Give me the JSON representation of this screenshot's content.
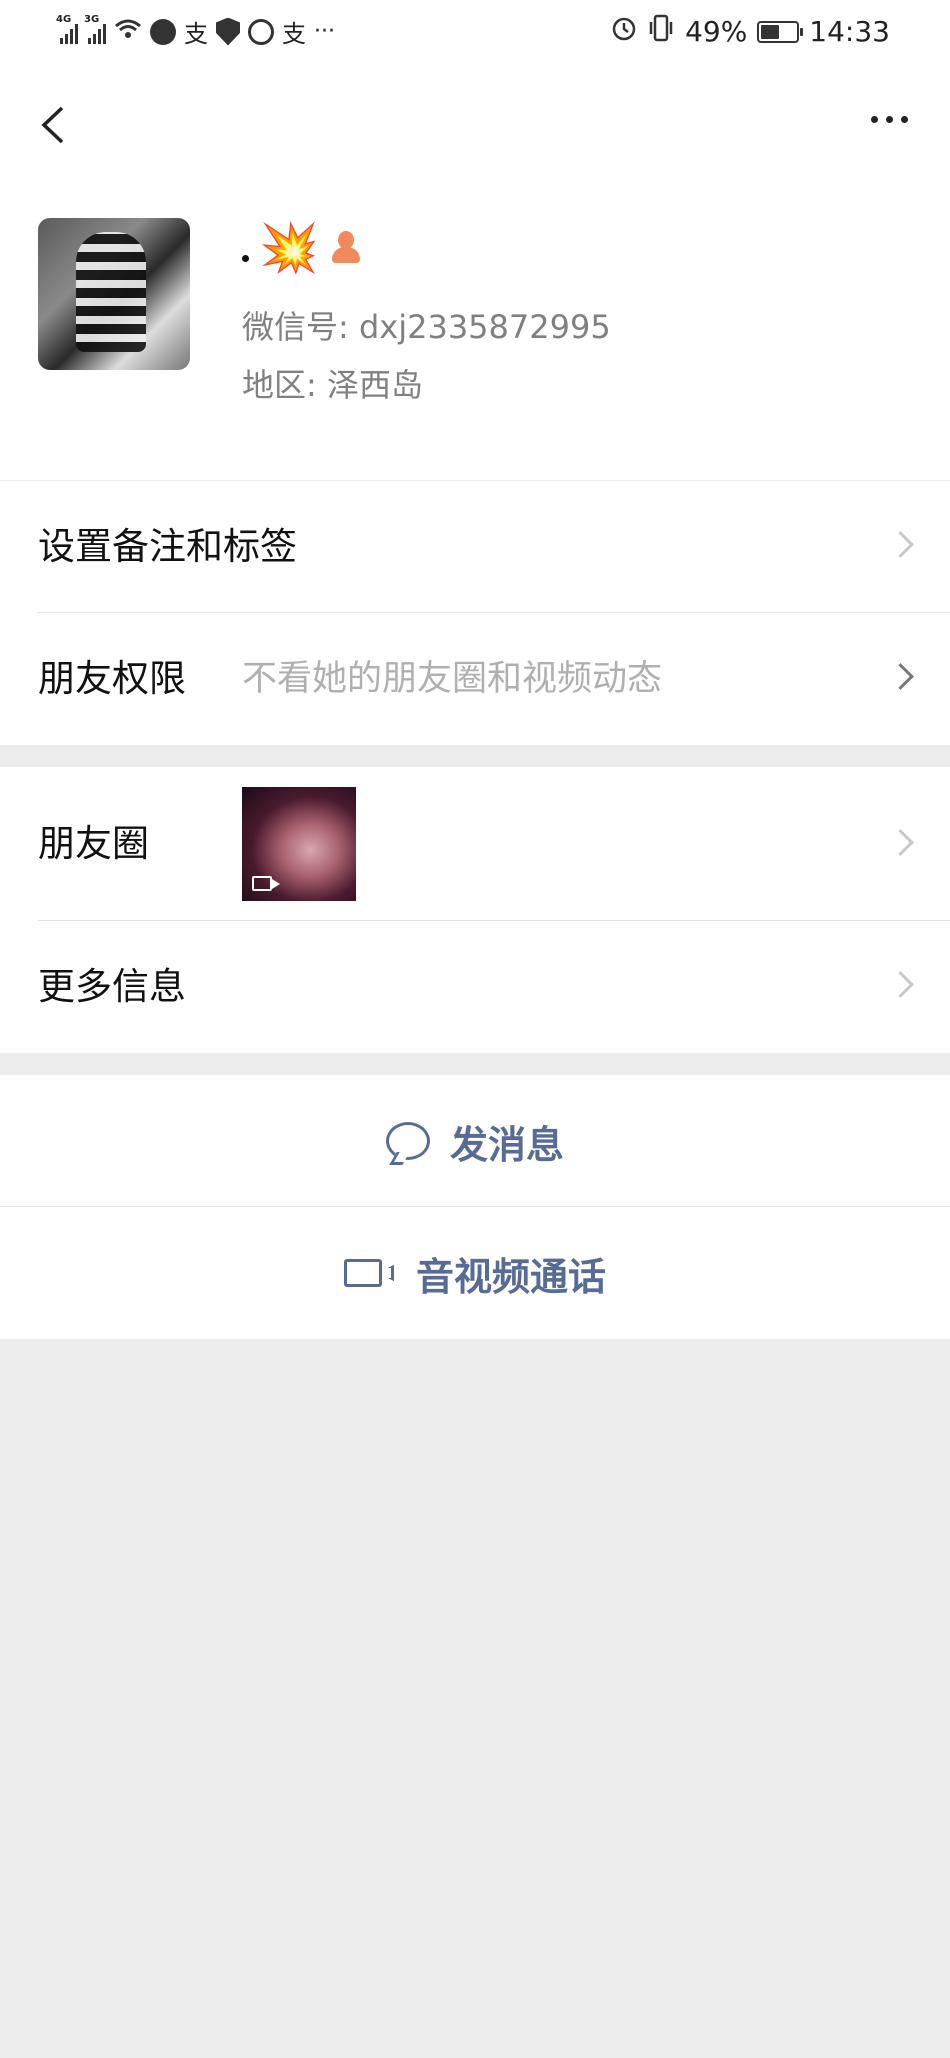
{
  "status_bar": {
    "net1": "4G",
    "net2": "3G",
    "alipay1": "支",
    "alipay2": "支",
    "overflow": "···",
    "battery_pct": "49%",
    "time": "14:33"
  },
  "nav": {
    "back_icon": "chevron-left-icon",
    "more_icon": "ellipsis-icon"
  },
  "profile": {
    "nickname_dot": "·",
    "nickname_emoji": "💥",
    "gender_icon": "female-icon",
    "wechat_id": "微信号: dxj2335872995",
    "region": "地区: 泽西岛"
  },
  "rows": {
    "remark_label": "设置备注和标签",
    "permission_label": "朋友权限",
    "permission_value": "不看她的朋友圈和视频动态",
    "moments_label": "朋友圈",
    "more_info_label": "更多信息"
  },
  "actions": {
    "message_label": "发消息",
    "call_label": "音视频通话"
  },
  "colors": {
    "link": "#576b95",
    "background": "#ededed",
    "secondary_text": "#808080"
  }
}
